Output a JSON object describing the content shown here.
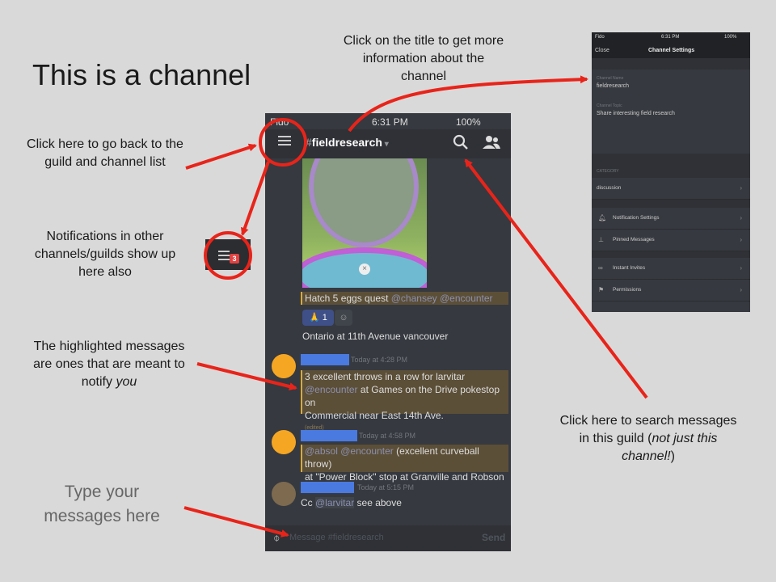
{
  "slide": {
    "title": "This is a channel",
    "callout_title": "Click on the title to get more information about the channel",
    "callout_back": "Click here to go back to the guild and channel list",
    "callout_notifications": "Notifications in other channels/guilds show up here also",
    "callout_highlight_pre": "The highlighted messages are ones that are meant to notify ",
    "callout_highlight_em": "you",
    "callout_search_pre": "Click here to search messages in this guild (",
    "callout_search_em": "not just this channel!",
    "callout_search_post": ")",
    "callout_type": "Type your messages here"
  },
  "phone": {
    "carrier": "Fido",
    "time": "6:31 PM",
    "battery": "100%",
    "channel_name": "fieldresearch",
    "messages": {
      "hatch_text": "Hatch 5 eggs quest",
      "hatch_mention1": "@chansey",
      "hatch_mention2": "@encounter",
      "reaction_count": "1",
      "ontario_text": "Ontario at 11th Avenue vancouver",
      "m1_time": "Today at 4:28 PM",
      "m1_line1": "3 excellent throws in a row for larvitar",
      "m1_mention": "@encounter",
      "m1_rest": " at Games on the Drive pokestop on",
      "m1_line3": "Commercial near East 14th Ave.",
      "m1_edited": "(edited)",
      "m2_time": "Today at 4:58 PM",
      "m2_mention1": "@absol",
      "m2_mention2": "@encounter",
      "m2_rest": " (excellent curveball throw)",
      "m2_line2": "at \"Power Block\" stop at Granville and Robson",
      "m3_time": "Today at 5:15 PM",
      "m3_pre": "Cc ",
      "m3_mention": "@larvitar",
      "m3_post": " see above"
    },
    "input_placeholder": "Message #fieldresearch",
    "send_label": "Send",
    "notif_badge": "3"
  },
  "settings": {
    "carrier": "Fido",
    "time": "6:31 PM",
    "battery": "100%",
    "close_label": "Close",
    "header": "Channel Settings",
    "channel_name_label": "Channel Name",
    "channel_name_value": "fieldresearch",
    "channel_topic_label": "Channel Topic",
    "channel_topic_value": "Share interesting field research",
    "category_label": "CATEGORY",
    "category_value": "discussion",
    "rows": {
      "notification_settings": "Notification Settings",
      "pinned_messages": "Pinned Messages",
      "instant_invites": "Instant Invites",
      "permissions": "Permissions"
    }
  },
  "colors": {
    "arrow": "#e8241a",
    "highlight": "#5c4f37",
    "name_placeholder": "#4a7ae0",
    "discord_avatar": "#f5a623"
  }
}
